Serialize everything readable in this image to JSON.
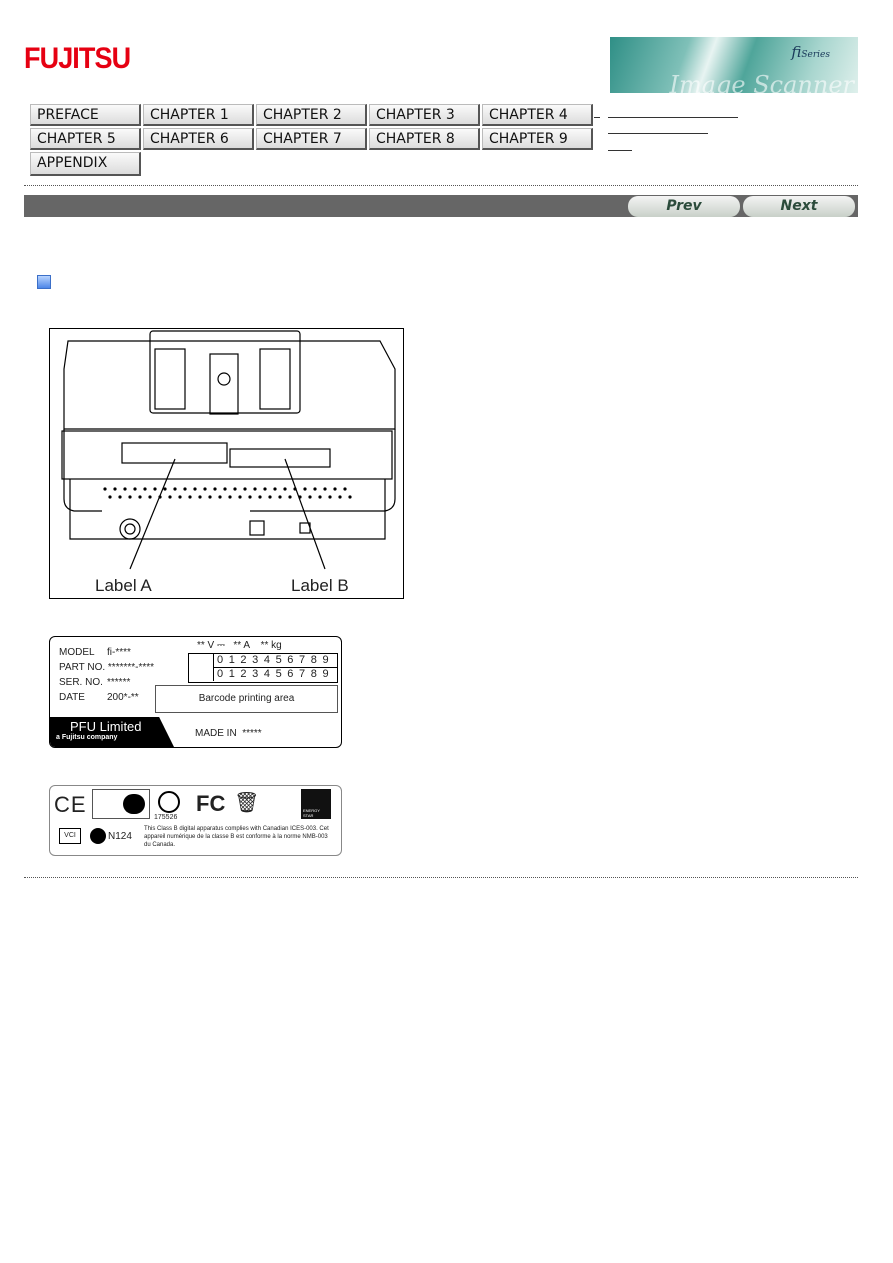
{
  "header": {
    "logo": "FUJITSU",
    "banner": {
      "series": "fi",
      "series_suffix": "Series",
      "tagline": "Image Scanner"
    }
  },
  "nav": {
    "buttons": [
      "PREFACE",
      "CHAPTER 1",
      "CHAPTER 2",
      "CHAPTER 3",
      "CHAPTER 4",
      "CHAPTER 5",
      "CHAPTER 6",
      "CHAPTER 7",
      "CHAPTER 8",
      "CHAPTER 9",
      "APPENDIX"
    ]
  },
  "pager": {
    "prev": "Prev",
    "next": "Next"
  },
  "figure": {
    "label_a": "Label A",
    "label_b": "Label B"
  },
  "label_b_sticker": {
    "model": "MODEL",
    "model_val": "fi-****",
    "part": "PART NO.",
    "part_val": "*******-****",
    "ser": "SER. NO.",
    "ser_val": "******",
    "date": "DATE",
    "date_val": "200*-**",
    "ratings": "** V ⎓   ** A    ** kg",
    "digits": "0123456789",
    "barcode": "Barcode printing area",
    "company": "PFU Limited",
    "company_sub": "a Fujitsu company",
    "made_in": "MADE IN  *****"
  },
  "cert_label": {
    "ce": "CE",
    "fc": "FC",
    "csa_num": "175526",
    "n124": "N124",
    "vci": "VCI",
    "text": "This Class B digital apparatus complies with Canadian ICES-003. Cet appareil numérique de la classe B est conforme à la norme NMB-003 du Canada.",
    "energy": "ENERGY STAR"
  },
  "colors": {
    "logo": "#e60012",
    "bar": "#666666"
  }
}
